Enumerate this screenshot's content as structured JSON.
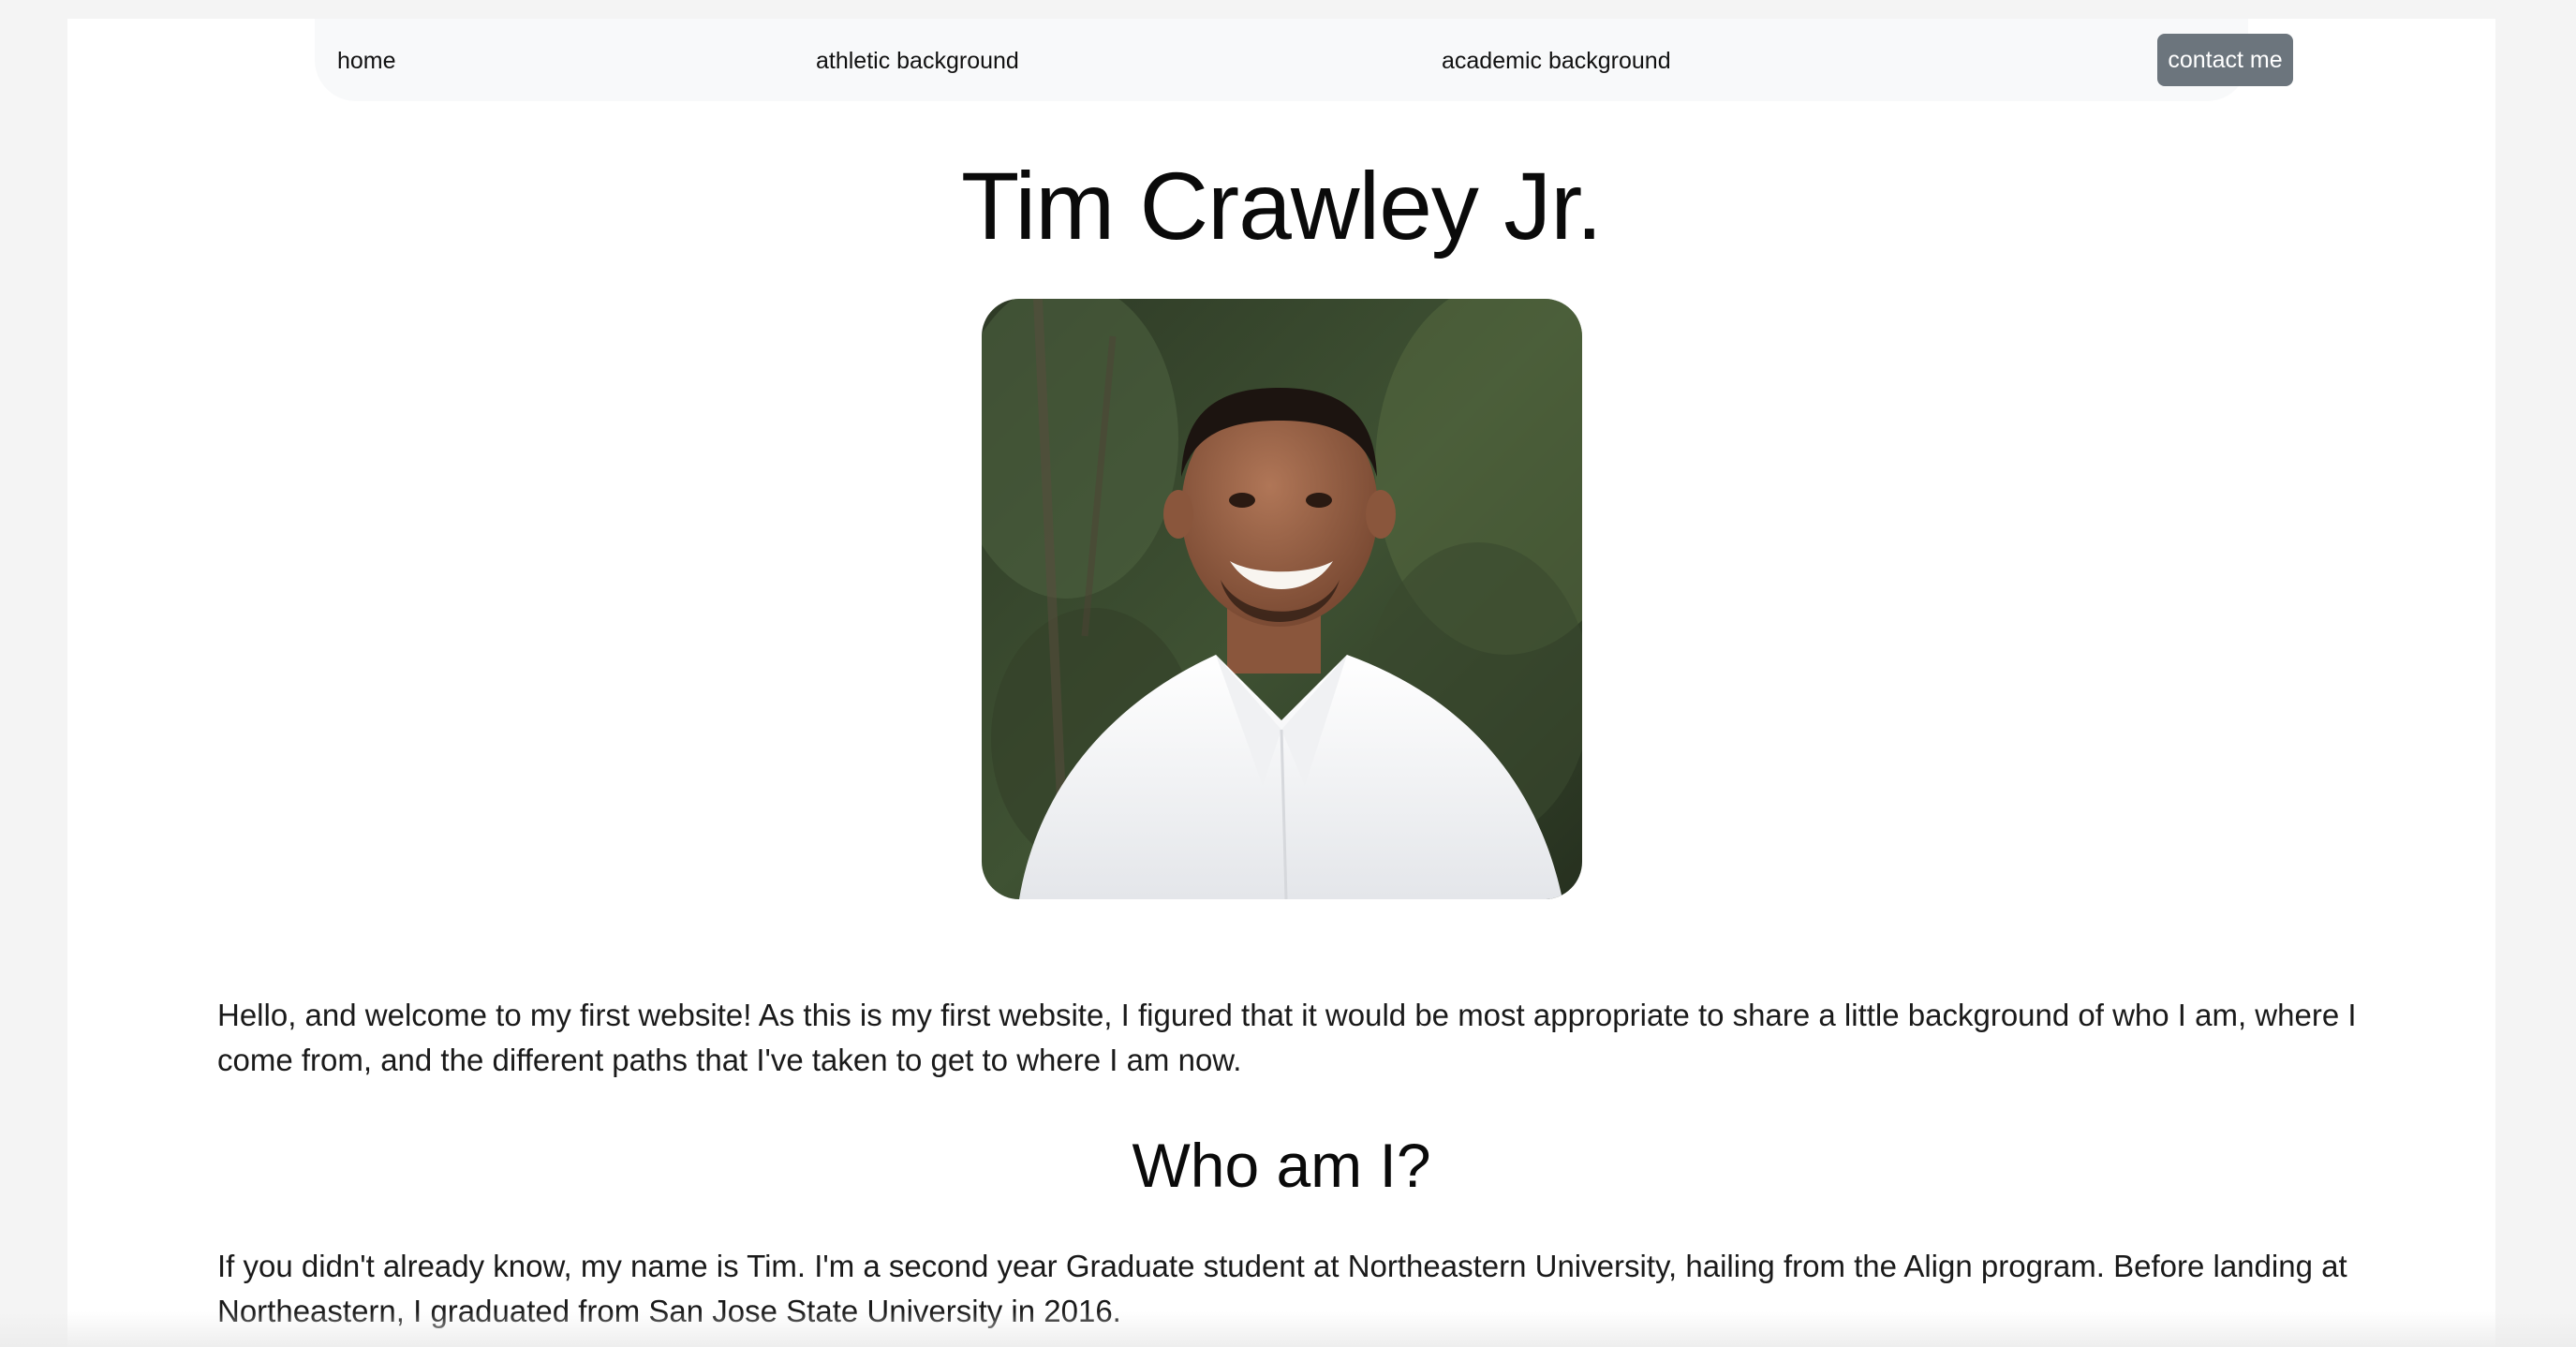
{
  "nav": {
    "home": "home",
    "athletic": "athletic background",
    "academic": "academic background",
    "contact": "contact me"
  },
  "title": "Tim Crawley Jr.",
  "intro": "Hello, and welcome to my first website! As this is my first website, I figured that it would be most appropriate to share a little background of who I am, where I come from, and the different paths that I've taken to get to where I am now.",
  "section": {
    "heading": "Who am I?",
    "body": "If you didn't already know, my name is Tim. I'm a second year Graduate student at Northeastern University, hailing from the Align program. Before landing at Northeastern, I graduated from San Jose State University in 2016."
  },
  "colors": {
    "navbar_bg": "#f8f9fa",
    "contact_button_bg": "#6c757d",
    "page_bg": "#ffffff"
  }
}
